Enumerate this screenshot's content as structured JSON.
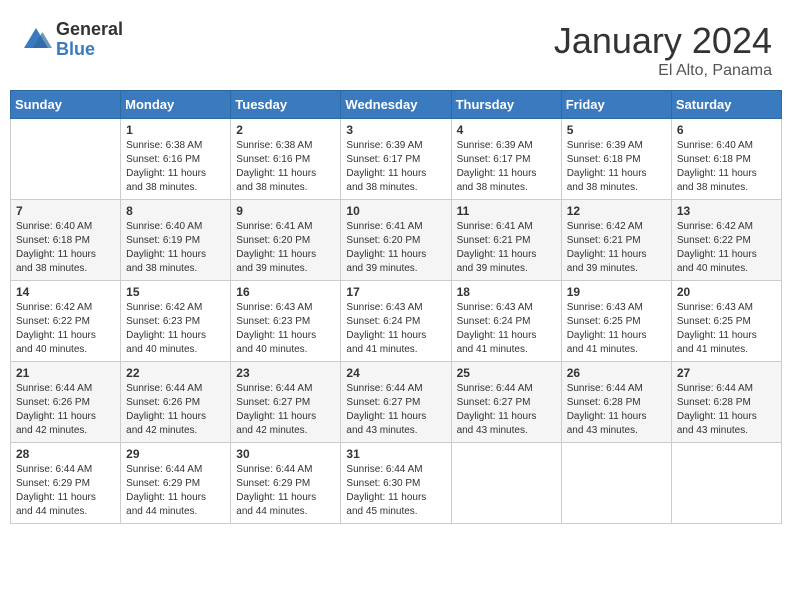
{
  "logo": {
    "general": "General",
    "blue": "Blue"
  },
  "title": "January 2024",
  "location": "El Alto, Panama",
  "days_header": [
    "Sunday",
    "Monday",
    "Tuesday",
    "Wednesday",
    "Thursday",
    "Friday",
    "Saturday"
  ],
  "weeks": [
    [
      {
        "day": "",
        "content": ""
      },
      {
        "day": "1",
        "content": "Sunrise: 6:38 AM\nSunset: 6:16 PM\nDaylight: 11 hours and 38 minutes."
      },
      {
        "day": "2",
        "content": "Sunrise: 6:38 AM\nSunset: 6:16 PM\nDaylight: 11 hours and 38 minutes."
      },
      {
        "day": "3",
        "content": "Sunrise: 6:39 AM\nSunset: 6:17 PM\nDaylight: 11 hours and 38 minutes."
      },
      {
        "day": "4",
        "content": "Sunrise: 6:39 AM\nSunset: 6:17 PM\nDaylight: 11 hours and 38 minutes."
      },
      {
        "day": "5",
        "content": "Sunrise: 6:39 AM\nSunset: 6:18 PM\nDaylight: 11 hours and 38 minutes."
      },
      {
        "day": "6",
        "content": "Sunrise: 6:40 AM\nSunset: 6:18 PM\nDaylight: 11 hours and 38 minutes."
      }
    ],
    [
      {
        "day": "7",
        "content": "Sunrise: 6:40 AM\nSunset: 6:18 PM\nDaylight: 11 hours and 38 minutes."
      },
      {
        "day": "8",
        "content": "Sunrise: 6:40 AM\nSunset: 6:19 PM\nDaylight: 11 hours and 38 minutes."
      },
      {
        "day": "9",
        "content": "Sunrise: 6:41 AM\nSunset: 6:20 PM\nDaylight: 11 hours and 39 minutes."
      },
      {
        "day": "10",
        "content": "Sunrise: 6:41 AM\nSunset: 6:20 PM\nDaylight: 11 hours and 39 minutes."
      },
      {
        "day": "11",
        "content": "Sunrise: 6:41 AM\nSunset: 6:21 PM\nDaylight: 11 hours and 39 minutes."
      },
      {
        "day": "12",
        "content": "Sunrise: 6:42 AM\nSunset: 6:21 PM\nDaylight: 11 hours and 39 minutes."
      },
      {
        "day": "13",
        "content": "Sunrise: 6:42 AM\nSunset: 6:22 PM\nDaylight: 11 hours and 40 minutes."
      }
    ],
    [
      {
        "day": "14",
        "content": "Sunrise: 6:42 AM\nSunset: 6:22 PM\nDaylight: 11 hours and 40 minutes."
      },
      {
        "day": "15",
        "content": "Sunrise: 6:42 AM\nSunset: 6:23 PM\nDaylight: 11 hours and 40 minutes."
      },
      {
        "day": "16",
        "content": "Sunrise: 6:43 AM\nSunset: 6:23 PM\nDaylight: 11 hours and 40 minutes."
      },
      {
        "day": "17",
        "content": "Sunrise: 6:43 AM\nSunset: 6:24 PM\nDaylight: 11 hours and 41 minutes."
      },
      {
        "day": "18",
        "content": "Sunrise: 6:43 AM\nSunset: 6:24 PM\nDaylight: 11 hours and 41 minutes."
      },
      {
        "day": "19",
        "content": "Sunrise: 6:43 AM\nSunset: 6:25 PM\nDaylight: 11 hours and 41 minutes."
      },
      {
        "day": "20",
        "content": "Sunrise: 6:43 AM\nSunset: 6:25 PM\nDaylight: 11 hours and 41 minutes."
      }
    ],
    [
      {
        "day": "21",
        "content": "Sunrise: 6:44 AM\nSunset: 6:26 PM\nDaylight: 11 hours and 42 minutes."
      },
      {
        "day": "22",
        "content": "Sunrise: 6:44 AM\nSunset: 6:26 PM\nDaylight: 11 hours and 42 minutes."
      },
      {
        "day": "23",
        "content": "Sunrise: 6:44 AM\nSunset: 6:27 PM\nDaylight: 11 hours and 42 minutes."
      },
      {
        "day": "24",
        "content": "Sunrise: 6:44 AM\nSunset: 6:27 PM\nDaylight: 11 hours and 43 minutes."
      },
      {
        "day": "25",
        "content": "Sunrise: 6:44 AM\nSunset: 6:27 PM\nDaylight: 11 hours and 43 minutes."
      },
      {
        "day": "26",
        "content": "Sunrise: 6:44 AM\nSunset: 6:28 PM\nDaylight: 11 hours and 43 minutes."
      },
      {
        "day": "27",
        "content": "Sunrise: 6:44 AM\nSunset: 6:28 PM\nDaylight: 11 hours and 43 minutes."
      }
    ],
    [
      {
        "day": "28",
        "content": "Sunrise: 6:44 AM\nSunset: 6:29 PM\nDaylight: 11 hours and 44 minutes."
      },
      {
        "day": "29",
        "content": "Sunrise: 6:44 AM\nSunset: 6:29 PM\nDaylight: 11 hours and 44 minutes."
      },
      {
        "day": "30",
        "content": "Sunrise: 6:44 AM\nSunset: 6:29 PM\nDaylight: 11 hours and 44 minutes."
      },
      {
        "day": "31",
        "content": "Sunrise: 6:44 AM\nSunset: 6:30 PM\nDaylight: 11 hours and 45 minutes."
      },
      {
        "day": "",
        "content": ""
      },
      {
        "day": "",
        "content": ""
      },
      {
        "day": "",
        "content": ""
      }
    ]
  ]
}
